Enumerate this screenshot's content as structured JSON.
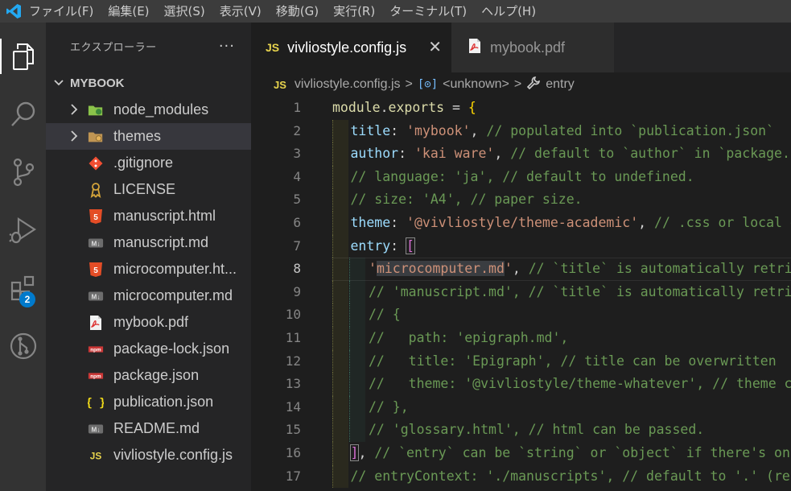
{
  "menu": [
    "ファイル(F)",
    "編集(E)",
    "選択(S)",
    "表示(V)",
    "移動(G)",
    "実行(R)",
    "ターミナル(T)",
    "ヘルプ(H)"
  ],
  "activity_bar": {
    "extensions_badge": "2"
  },
  "sidebar": {
    "title": "エクスプローラー",
    "more": "···",
    "folder": "MYBOOK",
    "items": [
      {
        "label": "node_modules",
        "icon": "node-modules-folder-icon",
        "folder": true
      },
      {
        "label": "themes",
        "icon": "themes-folder-icon",
        "folder": true,
        "selected": true
      },
      {
        "label": ".gitignore",
        "icon": "git-icon"
      },
      {
        "label": "LICENSE",
        "icon": "license-icon"
      },
      {
        "label": "manuscript.html",
        "icon": "html5-icon"
      },
      {
        "label": "manuscript.md",
        "icon": "markdown-icon"
      },
      {
        "label": "microcomputer.ht...",
        "icon": "html5-icon"
      },
      {
        "label": "microcomputer.md",
        "icon": "markdown-icon"
      },
      {
        "label": "mybook.pdf",
        "icon": "pdf-icon"
      },
      {
        "label": "package-lock.json",
        "icon": "npm-icon"
      },
      {
        "label": "package.json",
        "icon": "npm-icon"
      },
      {
        "label": "publication.json",
        "icon": "json-icon"
      },
      {
        "label": "README.md",
        "icon": "markdown-icon"
      },
      {
        "label": "vivliostyle.config.js",
        "icon": "js-icon"
      }
    ]
  },
  "tabs": [
    {
      "label": "vivliostyle.config.js",
      "badge": "JS",
      "close": "✕",
      "active": true
    },
    {
      "label": "mybook.pdf",
      "icon": "pdf-icon",
      "active": false
    }
  ],
  "breadcrumb": {
    "badge": "JS",
    "file": "vivliostyle.config.js",
    "symbol": "<unknown>",
    "property": "entry",
    "separator": ">"
  },
  "colors": {
    "keyword": "#9cdcfe",
    "string": "#ce9178",
    "comment": "#6a9955",
    "function": "#dcdcaa",
    "accent": "#007acc"
  },
  "code": {
    "active_line": 8,
    "lines": [
      {
        "n": "1",
        "g": 0,
        "t": [
          [
            "f",
            "module"
          ],
          [
            "p",
            "."
          ],
          [
            "f",
            "exports"
          ],
          [
            "p",
            " = "
          ],
          [
            "b1",
            "{"
          ]
        ]
      },
      {
        "n": "2",
        "g": 1,
        "t": [
          [
            "k",
            "title"
          ],
          [
            "p",
            ": "
          ],
          [
            "s",
            "'mybook'"
          ],
          [
            "p",
            ", "
          ],
          [
            "c",
            "// populated into `publication.json`"
          ]
        ]
      },
      {
        "n": "3",
        "g": 1,
        "t": [
          [
            "k",
            "author"
          ],
          [
            "p",
            ": "
          ],
          [
            "s",
            "'kai ware'"
          ],
          [
            "p",
            ", "
          ],
          [
            "c",
            "// default to `author` in `package.json`"
          ]
        ]
      },
      {
        "n": "4",
        "g": 1,
        "t": [
          [
            "c",
            "// language: 'ja', // default to undefined."
          ]
        ]
      },
      {
        "n": "5",
        "g": 1,
        "t": [
          [
            "c",
            "// size: 'A4', // paper size."
          ]
        ]
      },
      {
        "n": "6",
        "g": 1,
        "t": [
          [
            "k",
            "theme"
          ],
          [
            "p",
            ": "
          ],
          [
            "s",
            "'@vivliostyle/theme-academic'"
          ],
          [
            "p",
            ", "
          ],
          [
            "c",
            "// .css or local dir"
          ]
        ]
      },
      {
        "n": "7",
        "g": 1,
        "t": [
          [
            "k",
            "entry"
          ],
          [
            "p",
            ": "
          ],
          [
            "b2bm",
            "["
          ]
        ]
      },
      {
        "n": "8",
        "g": 2,
        "t": [
          [
            "s",
            "'"
          ],
          [
            "shl",
            "microcomputer.md"
          ],
          [
            "s",
            "'"
          ],
          [
            "p",
            ", "
          ],
          [
            "c",
            "// `title` is automatically retrieved"
          ]
        ]
      },
      {
        "n": "9",
        "g": 2,
        "t": [
          [
            "c",
            "// 'manuscript.md', // `title` is automatically retrieved"
          ]
        ]
      },
      {
        "n": "10",
        "g": 2,
        "t": [
          [
            "c",
            "// {"
          ]
        ]
      },
      {
        "n": "11",
        "g": 2,
        "t": [
          [
            "c",
            "//   path: 'epigraph.md',"
          ]
        ]
      },
      {
        "n": "12",
        "g": 2,
        "t": [
          [
            "c",
            "//   title: 'Epigraph', // title can be overwritten"
          ]
        ]
      },
      {
        "n": "13",
        "g": 2,
        "t": [
          [
            "c",
            "//   theme: '@vivliostyle/theme-whatever', // theme can be set"
          ]
        ]
      },
      {
        "n": "14",
        "g": 2,
        "t": [
          [
            "c",
            "// },"
          ]
        ]
      },
      {
        "n": "15",
        "g": 2,
        "t": [
          [
            "c",
            "// 'glossary.html', // html can be passed."
          ]
        ]
      },
      {
        "n": "16",
        "g": 1,
        "t": [
          [
            "b2bm",
            "]"
          ],
          [
            "p",
            ", "
          ],
          [
            "c",
            "// `entry` can be `string` or `object` if there's only single input"
          ]
        ]
      },
      {
        "n": "17",
        "g": 1,
        "t": [
          [
            "c",
            "// entryContext: './manuscripts', // default to '.' (relative to"
          ]
        ]
      }
    ]
  }
}
